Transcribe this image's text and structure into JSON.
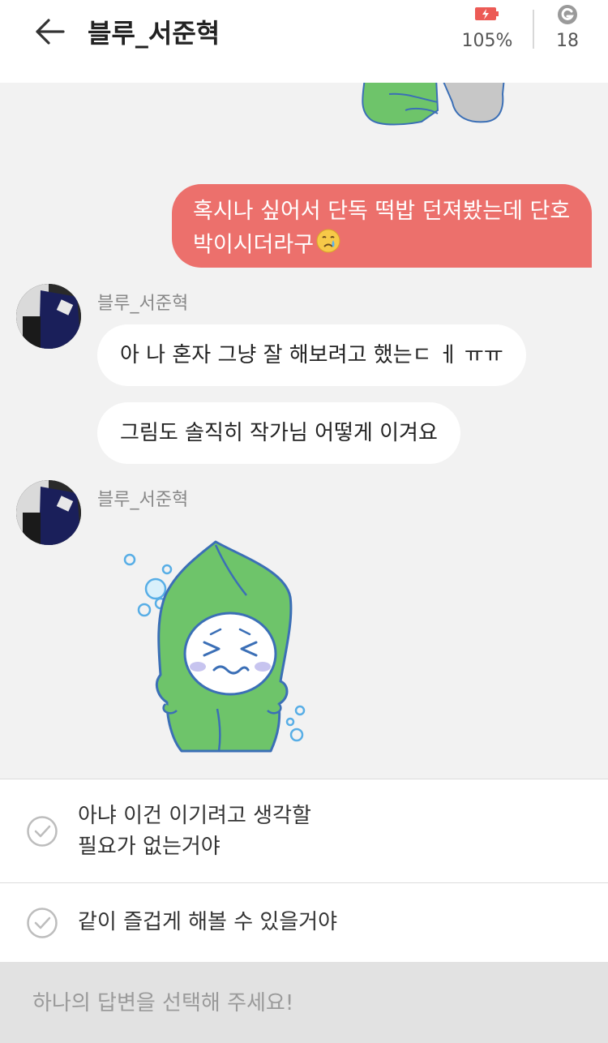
{
  "header": {
    "title": "블루_서준혁",
    "battery_percent": "105%",
    "coin_count": "18",
    "icons": {
      "back": "arrow-left-icon",
      "battery": "battery-icon",
      "coin": "coin-g-icon"
    }
  },
  "colors": {
    "my_bubble": "#ec706c",
    "their_bubble": "#ffffff",
    "chat_bg": "#f2f2f2",
    "sticker_green": "#6ec46a"
  },
  "messages": {
    "me_1": {
      "text": "혹시나 싶어서 단독 떡밥 던져봤는데 단호박이시더라구",
      "emoji": "crying-face"
    },
    "group_1": {
      "sender": "블루_서준혁",
      "bubbles": [
        "아 나 혼자 그냥 잘 해보려고 했는ㄷ ㅔ ㅠㅠ",
        "그림도 솔직히 작가님 어떻게 이겨요"
      ]
    },
    "group_2": {
      "sender": "블루_서준혁",
      "sticker": "crying-leaf-sticker"
    }
  },
  "options": [
    {
      "line1": "아냐 이건 이기려고 생각할",
      "line2": "필요가 없는거야"
    },
    {
      "line1": "같이 즐겁게 해볼 수 있을거야"
    }
  ],
  "footer": {
    "prompt": "하나의 답변을 선택해 주세요!"
  }
}
